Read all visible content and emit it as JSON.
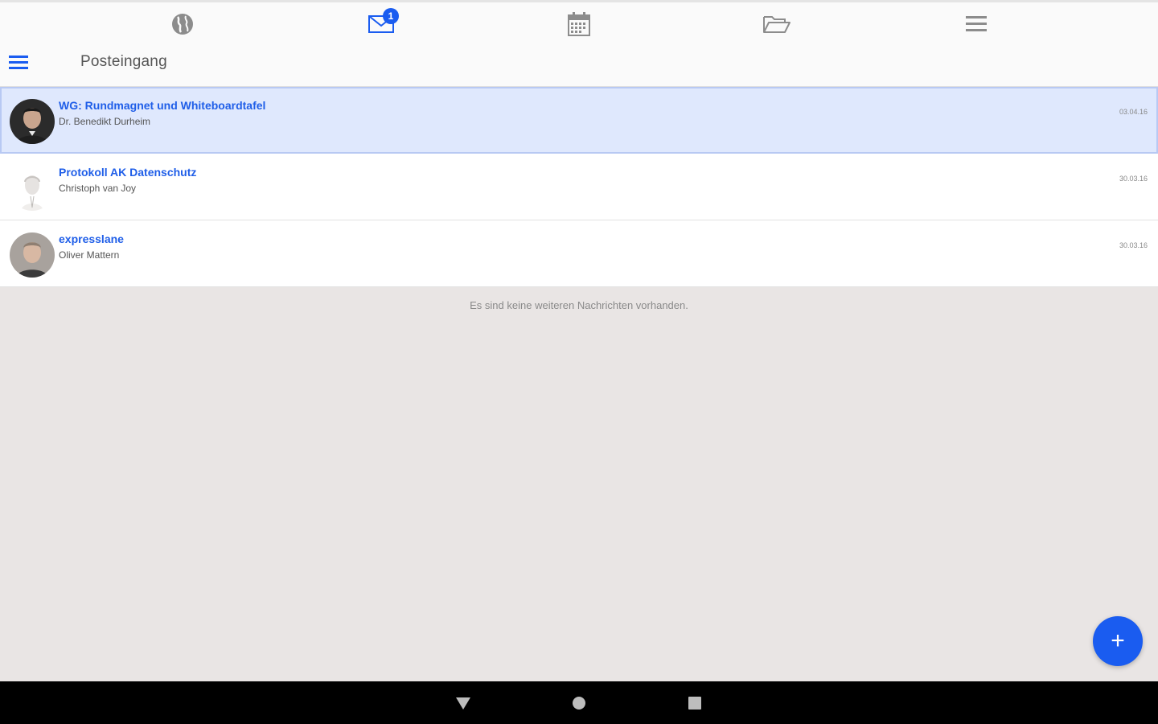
{
  "topnav": {
    "items": [
      {
        "icon": "globe-icon"
      },
      {
        "icon": "mail-icon",
        "badge": "1"
      },
      {
        "icon": "calendar-icon"
      },
      {
        "icon": "folder-icon"
      },
      {
        "icon": "menu-icon"
      }
    ]
  },
  "header": {
    "title": "Posteingang"
  },
  "messages": [
    {
      "subject": "WG: Rundmagnet und Whiteboardtafel",
      "sender": "Dr. Benedikt Durheim",
      "date": "03.04.16",
      "selected": true
    },
    {
      "subject": "Protokoll AK Datenschutz",
      "sender": "Christoph van Joy",
      "date": "30.03.16",
      "selected": false
    },
    {
      "subject": "expresslane",
      "sender": "Oliver Mattern",
      "date": "30.03.16",
      "selected": false
    }
  ],
  "empty_note": "Es sind keine weiteren Nachrichten vorhanden.",
  "fab": {
    "label": "+"
  },
  "colors": {
    "accent": "#1a5cf0",
    "selected_row": "#dfe8fd",
    "background": "#e9e5e4"
  }
}
